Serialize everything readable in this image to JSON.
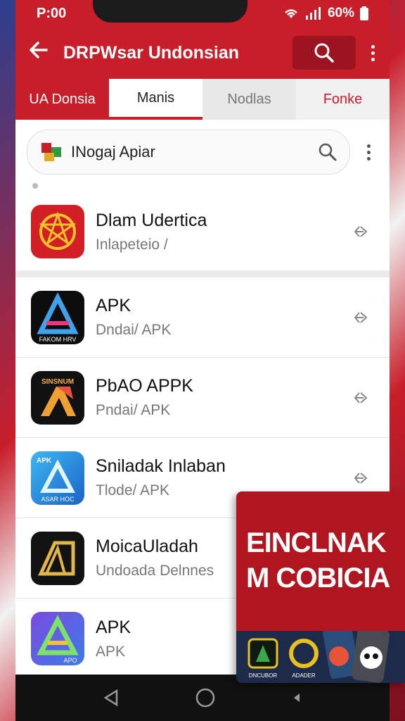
{
  "status": {
    "time": "P:00",
    "battery": "60%"
  },
  "appbar": {
    "title": "DRPWsar Undonsian"
  },
  "tabs": [
    {
      "label": "UA Donsia"
    },
    {
      "label": "Manis"
    },
    {
      "label": "Nodlas"
    },
    {
      "label": "Fonke"
    }
  ],
  "search": {
    "text": "INogaj Apiar"
  },
  "apps": [
    {
      "name": "Dlam Udertica",
      "sub": "Inlapeteio /"
    },
    {
      "name": "APK",
      "sub": "Dndai/ APK",
      "icon_caption": "FAKOM HRV"
    },
    {
      "name": "PbAO APPK",
      "sub": "Pndai/ APK",
      "icon_caption": "SINSNUM"
    },
    {
      "name": "Sniladak Inlaban",
      "sub": "Tlode/ APK",
      "icon_caption_top": "APK",
      "icon_caption": "ASAR HOC"
    },
    {
      "name": "MoicaUladah",
      "sub": "Undoada Delnnes"
    },
    {
      "name": "APK",
      "sub": "APK",
      "icon_caption": "APO"
    }
  ],
  "promo": {
    "line1": "EINCLNAK",
    "line2": "M COBICIA",
    "cap1": "DNCUBOR",
    "cap2": "ADADER"
  },
  "colors": {
    "accent": "#c81e2a",
    "dark_accent": "#9c1420"
  }
}
